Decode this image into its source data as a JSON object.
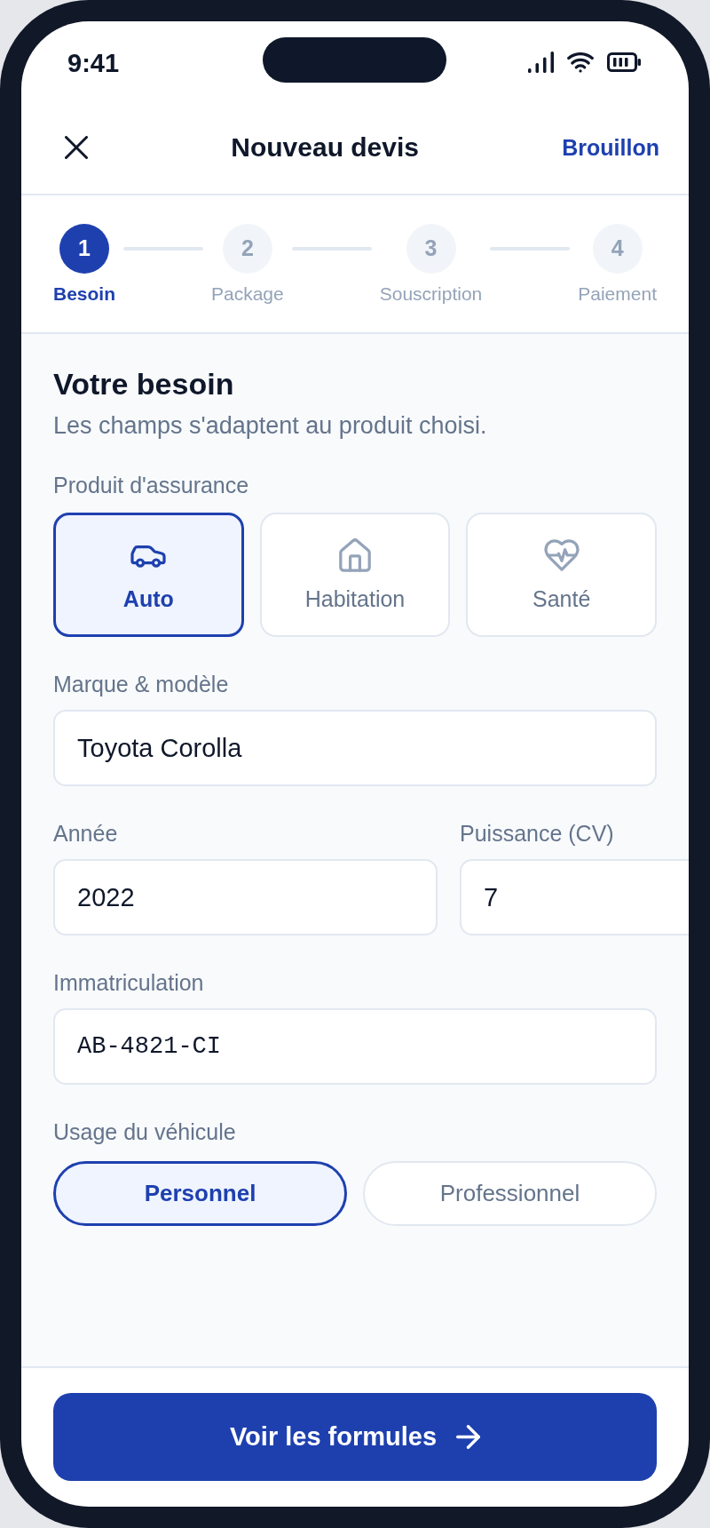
{
  "status_bar": {
    "time": "9:41"
  },
  "header": {
    "title": "Nouveau devis",
    "action": "Brouillon"
  },
  "stepper": [
    {
      "number": "1",
      "label": "Besoin",
      "selected": true
    },
    {
      "number": "2",
      "label": "Package",
      "selected": false
    },
    {
      "number": "3",
      "label": "Souscription",
      "selected": false
    },
    {
      "number": "4",
      "label": "Paiement",
      "selected": false
    }
  ],
  "section": {
    "title": "Votre besoin",
    "subtitle": "Les champs s'adaptent au produit choisi."
  },
  "product": {
    "label": "Produit d'assurance",
    "options": [
      {
        "kind": "vehicle",
        "label": "Auto",
        "selected": true
      },
      {
        "kind": "home",
        "label": "Habitation",
        "selected": false
      },
      {
        "kind": "health",
        "label": "Santé",
        "selected": false
      }
    ]
  },
  "field_rows": [
    [
      {
        "kind": "text",
        "label": "Marque & modèle",
        "value": "Toyota Corolla"
      }
    ],
    [
      {
        "kind": "text",
        "label": "Année",
        "value": "2022"
      },
      {
        "kind": "text",
        "label": "Puissance (CV)",
        "value": "7"
      }
    ],
    [
      {
        "kind": "mono",
        "label": "Immatriculation",
        "value": "AB-4821-CI"
      }
    ]
  ],
  "usage": {
    "label": "Usage du véhicule",
    "options": [
      {
        "label": "Personnel",
        "selected": true
      },
      {
        "label": "Professionnel",
        "selected": false
      }
    ]
  },
  "footer": {
    "button": "Voir les formules"
  }
}
